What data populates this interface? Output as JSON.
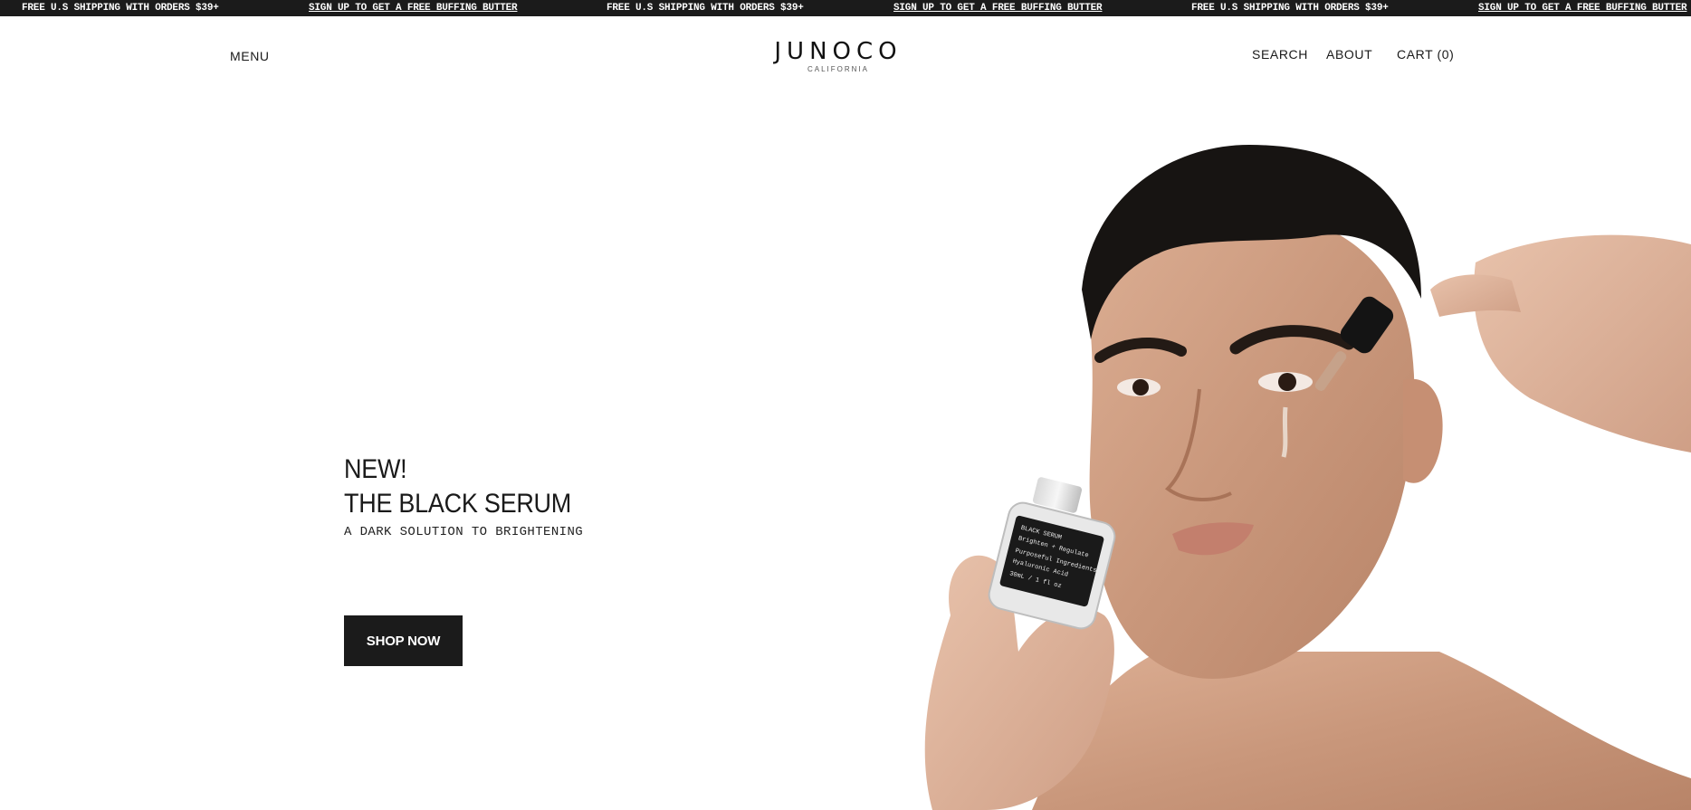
{
  "announcement_bar": {
    "items": [
      {
        "text": "FREE U.S SHIPPING WITH ORDERS $39+",
        "is_link": false
      },
      {
        "text": "SIGN UP TO GET A FREE BUFFING BUTTER",
        "is_link": true
      },
      {
        "text": "FREE U.S SHIPPING WITH ORDERS $39+",
        "is_link": false
      },
      {
        "text": "SIGN UP TO GET A FREE BUFFING BUTTER",
        "is_link": true
      },
      {
        "text": "FREE U.S SHIPPING WITH ORDERS $39+",
        "is_link": false
      },
      {
        "text": "SIGN UP TO GET A FREE BUFFING BUTTER",
        "is_link": true
      }
    ]
  },
  "header": {
    "menu_label": "MENU",
    "logo": {
      "brand": "JUNOCO",
      "tagline": "CALIFORNIA"
    },
    "search_label": "SEARCH",
    "about_label": "ABOUT",
    "cart_label": "CART (0)"
  },
  "hero": {
    "eyebrow": "NEW!",
    "title": "THE BLACK SERUM",
    "subtitle": "A DARK SOLUTION TO BRIGHTENING",
    "cta_label": "SHOP NOW",
    "image": {
      "bottle_label_lines": [
        "BLACK SERUM",
        "Brighten + Regulate",
        "Purposeful Ingredients",
        "Hyaluronic Acid",
        "30mL / 1 fl oz"
      ]
    }
  },
  "colors": {
    "announcement_bg": "#1b1b1b",
    "button_bg": "#1b1b1b",
    "text": "#1a1a1a",
    "background": "#ffffff"
  }
}
